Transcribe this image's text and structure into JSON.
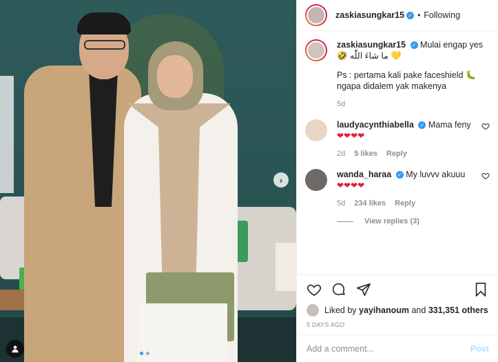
{
  "post": {
    "owner": "zaskiasungkar15",
    "follow_status": "Following",
    "separator": "•",
    "carousel": {
      "slides": 2,
      "active": 1
    },
    "accent": "#3897f0"
  },
  "comments": [
    {
      "user": "zaskiasungkar15",
      "verified": true,
      "text": "Mulai engap yes",
      "line2": "🤣 ما شاءَ اللّٰه 💛",
      "ps": "Ps : pertama kali pake faceshield 🐛 ngapa didalem yak makenya",
      "age": "5d"
    },
    {
      "user": "laudyacynthiabella",
      "verified": true,
      "text": "Mama feny",
      "hearts": "❤❤❤❤",
      "age": "2d",
      "likes": "5 likes",
      "reply": "Reply"
    },
    {
      "user": "wanda_haraa",
      "verified": true,
      "text": "My luvvv akuuu",
      "hearts": "❤❤❤❤",
      "age": "5d",
      "likes": "234 likes",
      "reply": "Reply",
      "view_replies": "View replies (3)"
    }
  ],
  "liked_by": {
    "prefix": "Liked by",
    "user": "yayihanoum",
    "and": "and",
    "count": "331,351 others"
  },
  "timestamp": "5 DAYS AGO",
  "add_comment": {
    "placeholder": "Add a comment...",
    "post_label": "Post"
  },
  "icons": [
    "heart-icon",
    "comment-icon",
    "share-icon",
    "bookmark-icon",
    "chevron-right-icon",
    "user-tag-icon",
    "verified-icon"
  ]
}
